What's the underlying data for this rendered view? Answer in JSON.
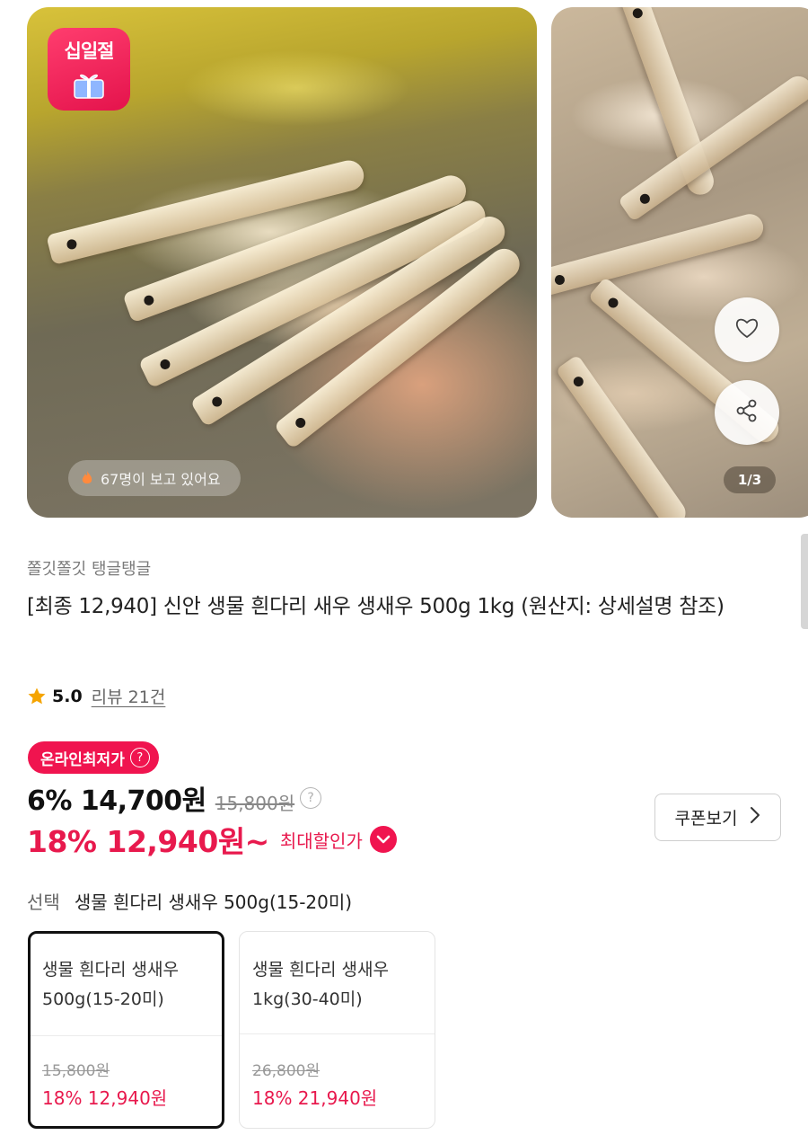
{
  "gallery": {
    "sticker": "십일절",
    "viewers": "67명이 보고 있어요",
    "counter": "1/3"
  },
  "product": {
    "brand": "쫄깃쫄깃 탱글탱글",
    "title": "[최종 12,940] 신안 생물 흰다리 새우 생새우 500g 1kg (원산지: 상세설명 참조)",
    "rating": "5.0",
    "reviews": "리뷰 21건"
  },
  "pricing": {
    "badge": "온라인최저가",
    "discount_price": "6% 14,700원",
    "original_price": "15,800원",
    "best_price": "18% 12,940원~",
    "best_label": "최대할인가",
    "coupon_button": "쿠폰보기",
    "colors": {
      "accent": "#f0144f",
      "price_red": "#e8194d"
    }
  },
  "selection": {
    "label": "선택",
    "value": "생물 흰다리 생새우 500g(15-20미)",
    "options": [
      {
        "name": "생물 흰다리 생새우 500g(15-20미)",
        "original": "15,800원",
        "price": "18% 12,940원",
        "selected": true
      },
      {
        "name": "생물 흰다리 생새우 1kg(30-40미)",
        "original": "26,800원",
        "price": "18% 21,940원",
        "selected": false
      }
    ]
  },
  "icons": [
    "gift-icon",
    "fire-icon",
    "heart-icon",
    "share-icon",
    "star-icon",
    "help-icon",
    "chevron-down-icon",
    "chevron-right-icon"
  ]
}
